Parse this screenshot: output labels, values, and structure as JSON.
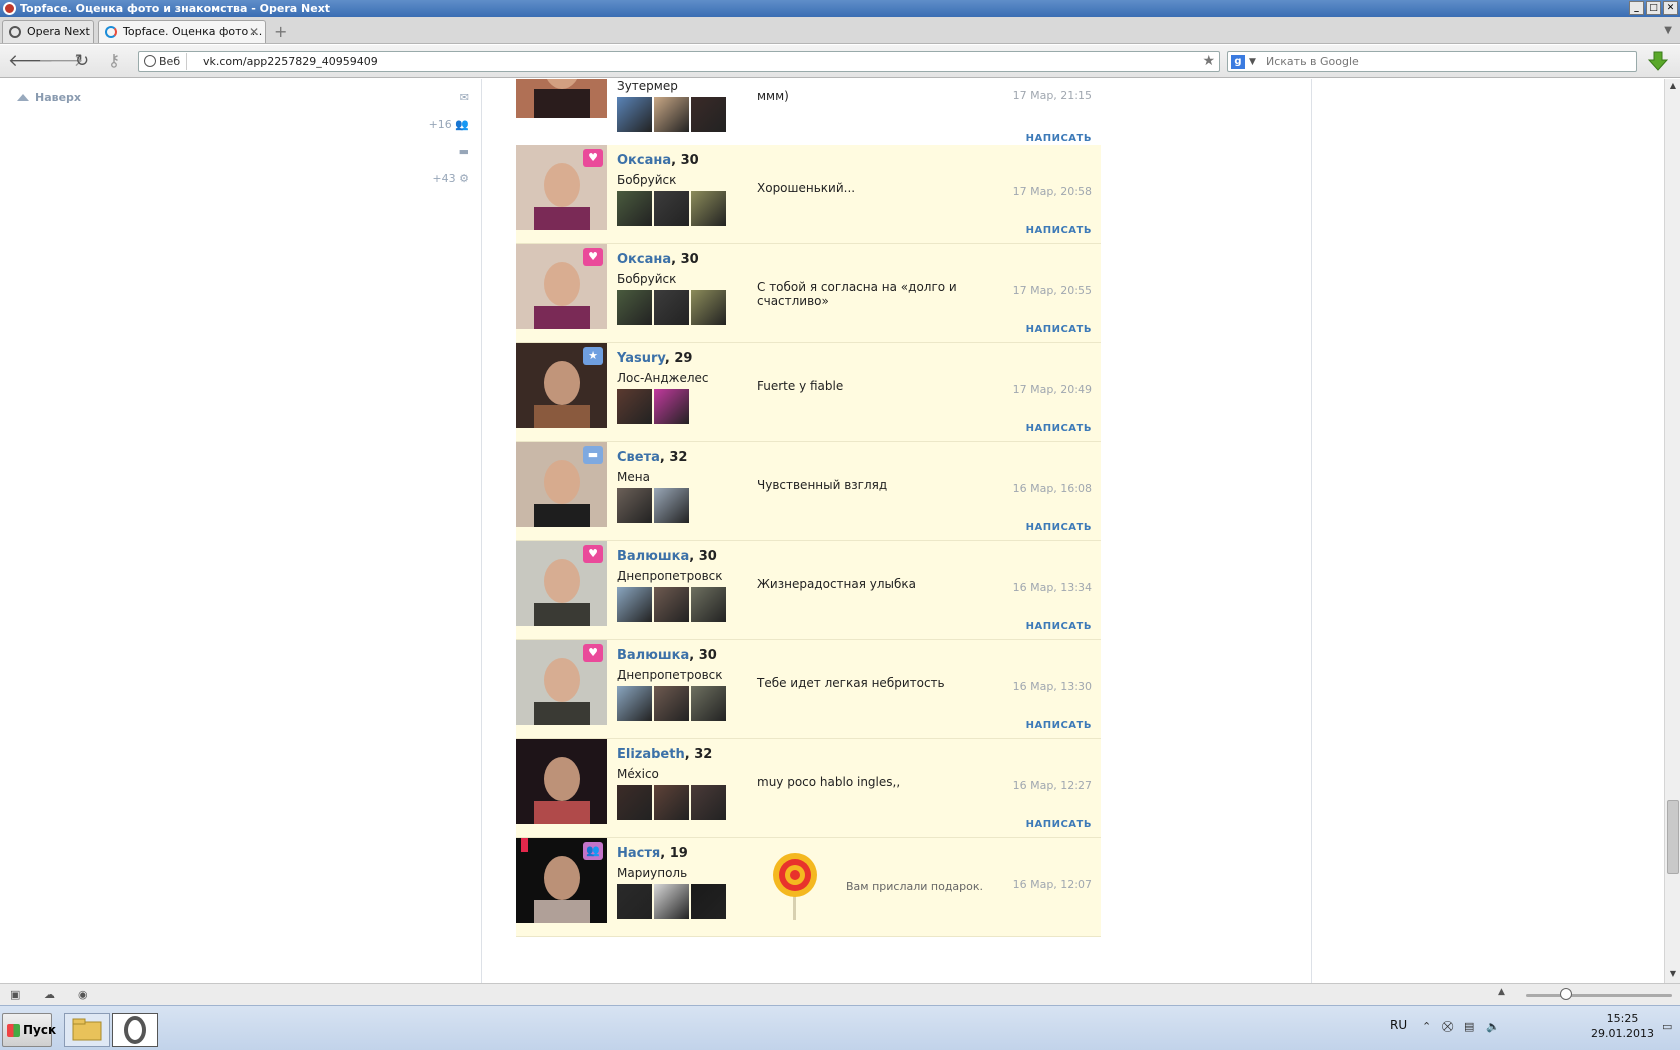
{
  "window": {
    "title": "Topface. Оценка фото и знакомства - Opera Next"
  },
  "tabs": [
    {
      "label": "Opera Next"
    },
    {
      "label": "Topface. Оценка фото ..."
    }
  ],
  "address_bar": {
    "chip_label": "Веб",
    "url": "vk.com/app2257829_40959409"
  },
  "search": {
    "placeholder": "Искать в Google",
    "engine_label": "g"
  },
  "sidebar": {
    "top_link": "Наверх",
    "count_friends": "+16",
    "count_settings": "+43"
  },
  "entries": [
    {
      "name": "",
      "age": "",
      "city": "Зутермер",
      "message": "ммм)",
      "time": "17 Мар, 21:15",
      "badge": "",
      "thumbs": [
        "#5a84b8",
        "#c9a886",
        "#3a2a28"
      ],
      "avatar_colors": [
        "#b07055",
        "#2a1c1c"
      ]
    },
    {
      "name": "Оксана",
      "age": "30",
      "city": "Бобруйск",
      "message": "Хорошенький...",
      "time": "17 Мар, 20:58",
      "badge": "heart",
      "thumbs": [
        "#4a5b3e",
        "#3c3c3c",
        "#8c8c5a"
      ],
      "avatar_colors": [
        "#d8c6b8",
        "#7a2a56"
      ]
    },
    {
      "name": "Оксана",
      "age": "30",
      "city": "Бобруйск",
      "message": "С тобой я согласна на «долго и счастливо»",
      "time": "17 Мар, 20:55",
      "badge": "heart",
      "thumbs": [
        "#4a5b3e",
        "#3c3c3c",
        "#8c8c5a"
      ],
      "avatar_colors": [
        "#d8c6b8",
        "#7a2a56"
      ]
    },
    {
      "name": "Yasury",
      "age": "29",
      "city": "Лос-Анджелес",
      "message": "Fuerte y fiable",
      "time": "17 Мар, 20:49",
      "badge": "star",
      "thumbs": [
        "#5b3a30",
        "#c23a9e"
      ],
      "avatar_colors": [
        "#3a2a24",
        "#8a5a3e"
      ]
    },
    {
      "name": "Света",
      "age": "32",
      "city": "Мена",
      "message": "Чувственный взгляд",
      "time": "16 Мар, 16:08",
      "badge": "chat",
      "thumbs": [
        "#6b6058",
        "#9aa8b8"
      ],
      "avatar_colors": [
        "#c9b8a8",
        "#1e1e1e"
      ]
    },
    {
      "name": "Валюшка",
      "age": "30",
      "city": "Днепропетровск",
      "message": "Жизнерадостная улыбка",
      "time": "16 Мар, 13:34",
      "badge": "heart",
      "thumbs": [
        "#8aa6c0",
        "#6e5a50",
        "#6e7060"
      ],
      "avatar_colors": [
        "#c8c8c0",
        "#3a3a34"
      ]
    },
    {
      "name": "Валюшка",
      "age": "30",
      "city": "Днепропетровск",
      "message": "Тебе идет легкая небритость",
      "time": "16 Мар, 13:30",
      "badge": "heart",
      "thumbs": [
        "#8aa6c0",
        "#6e5a50",
        "#6e7060"
      ],
      "avatar_colors": [
        "#c8c8c0",
        "#3a3a34"
      ]
    },
    {
      "name": "Elizabeth",
      "age": "32",
      "city": "México",
      "message": "muy poco hablo ingles,,",
      "time": "16 Мар, 12:27",
      "badge": "",
      "thumbs": [
        "#3c2c28",
        "#5e4238",
        "#4a3a38"
      ],
      "avatar_colors": [
        "#1e1418",
        "#b04a4a"
      ]
    },
    {
      "name": "Настя",
      "age": "19",
      "city": "Мариуполь",
      "message": "",
      "gift_text": "Вам прислали подарок.",
      "time": "16 Мар, 12:07",
      "badge": "group",
      "thumbs": [
        "#2a2a2a",
        "#d8d8d8",
        "#1a1a1a"
      ],
      "avatar_colors": [
        "#0e0e0e",
        "#b0a098"
      ]
    }
  ],
  "write_label": "НАПИСАТЬ",
  "taskbar": {
    "start_label": "Пуск",
    "lang": "RU",
    "time": "15:25",
    "date": "29.01.2013"
  },
  "colors": {
    "link": "#3c71a8",
    "entry_bg": "#fffbe0",
    "heart_badge": "#ea4a9a"
  }
}
